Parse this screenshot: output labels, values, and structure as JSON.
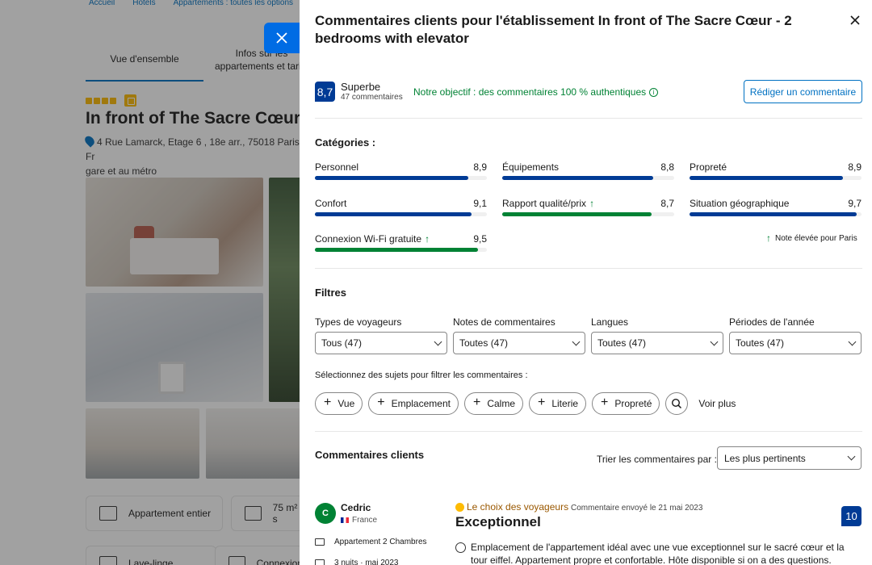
{
  "background": {
    "breadcrumbs": [
      "Accueil",
      "Hôtels",
      "Appartements : toutes les options"
    ],
    "tabs": [
      "Vue d'ensemble",
      "Infos sur les appartements et tarifs"
    ],
    "hotel_title": "In front of The Sacre Cœur -",
    "address": "4 Rue Lamarck, Etage 6 , 18e arr., 75018 Paris, Fr",
    "address_tail": "gare et au métro",
    "features": [
      "Appartement entier",
      "75 m² s",
      "Lave-linge",
      "Connexion"
    ],
    "stars": 4
  },
  "panel": {
    "title": "Commentaires clients pour l'établissement In front of The Sacre Cœur - 2 bedrooms with elevator",
    "score": "8,7",
    "score_word": "Superbe",
    "review_count": "47 commentaires",
    "authentic_text": "Notre objectif : des commentaires 100 % authentiques",
    "write_button": "Rédiger un commentaire",
    "categories_heading": "Catégories :",
    "categories": [
      {
        "name": "Personnel",
        "value": "8,9",
        "score": 8.9,
        "high": false
      },
      {
        "name": "Équipements",
        "value": "8,8",
        "score": 8.8,
        "high": false
      },
      {
        "name": "Propreté",
        "value": "8,9",
        "score": 8.9,
        "high": false
      },
      {
        "name": "Confort",
        "value": "9,1",
        "score": 9.1,
        "high": false
      },
      {
        "name": "Rapport qualité/prix",
        "value": "8,7",
        "score": 8.7,
        "high": true
      },
      {
        "name": "Situation géographique",
        "value": "9,7",
        "score": 9.7,
        "high": false
      },
      {
        "name": "Connexion Wi-Fi gratuite",
        "value": "9,5",
        "score": 9.5,
        "high": true
      }
    ],
    "high_note": "Note élevée pour Paris",
    "filters_heading": "Filtres",
    "filters": [
      {
        "label": "Types de voyageurs",
        "value": "Tous (47)"
      },
      {
        "label": "Notes de commentaires",
        "value": "Toutes (47)"
      },
      {
        "label": "Langues",
        "value": "Toutes (47)"
      },
      {
        "label": "Périodes de l'année",
        "value": "Toutes (47)"
      }
    ],
    "topics_hint": "Sélectionnez des sujets pour filtrer les commentaires :",
    "topics": [
      "Vue",
      "Emplacement",
      "Calme",
      "Literie",
      "Propreté"
    ],
    "see_more": "Voir plus",
    "reviews_heading": "Commentaires clients",
    "sort_label": "Trier les commentaires par :",
    "sort_value": "Les plus pertinents",
    "review": {
      "initial": "C",
      "name": "Cedric",
      "country": "France",
      "room": "Appartement 2 Chambres",
      "stay": "3 nuits · mai 2023",
      "choice": "Le choix des voyageurs",
      "sent": "Commentaire envoyé le 21 mai 2023",
      "headline": "Exceptionnel",
      "score": "10",
      "text": "Emplacement de l'appartement idéal avec une vue exceptionnel sur le sacré cœur et la tour eiffel. Appartement propre et confortable. Hôte disponible si on a des questions."
    }
  },
  "colors": {
    "bar_blue": "#003b95",
    "bar_green": "#008234",
    "accent": "#0071c2",
    "close_badge": "#006ce4"
  }
}
